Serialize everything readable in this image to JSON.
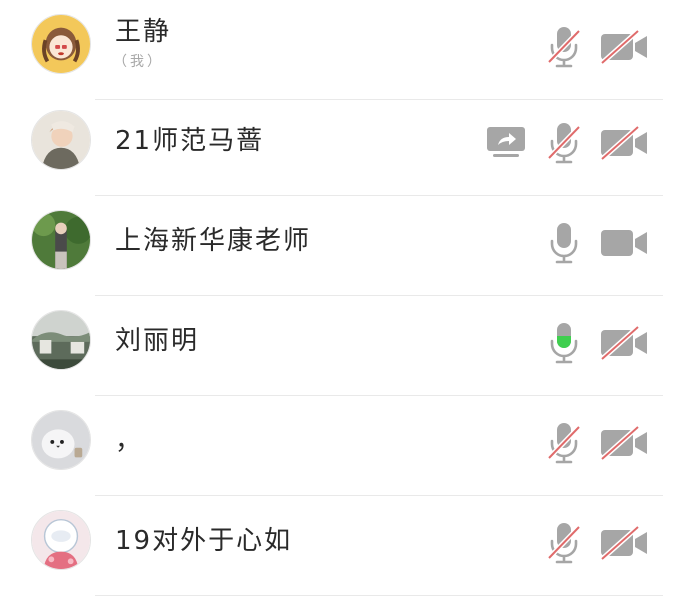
{
  "participants": [
    {
      "name": "王静",
      "note": "（我）",
      "mic": "muted",
      "camera": "off",
      "sharing": false
    },
    {
      "name": "21师范马蔷",
      "mic": "muted",
      "camera": "off",
      "sharing": true
    },
    {
      "name": "上海新华康老师",
      "mic": "on",
      "camera": "on",
      "sharing": false
    },
    {
      "name": "刘丽明",
      "mic": "speaking",
      "camera": "off",
      "sharing": false
    },
    {
      "name": "，",
      "mic": "muted",
      "camera": "off",
      "sharing": false
    },
    {
      "name": "19对外于心如",
      "mic": "muted",
      "camera": "off",
      "sharing": false
    }
  ],
  "icons": {
    "mic": "microphone-icon",
    "mic_muted": "microphone-muted-icon",
    "camera": "video-camera-icon",
    "camera_off": "video-camera-off-icon",
    "share": "screen-share-icon"
  },
  "colors": {
    "icon_gray": "#a6a6a6",
    "mute_slash": "#e06b6b",
    "speaking_green": "#3fcf4f",
    "divider": "#e9e9e9"
  }
}
